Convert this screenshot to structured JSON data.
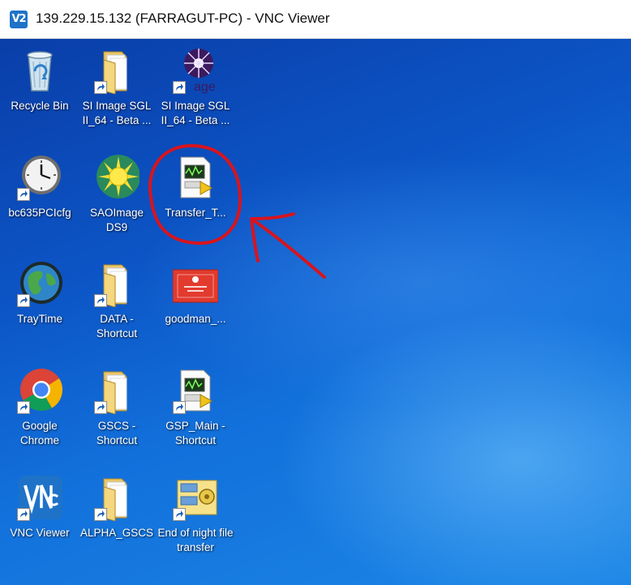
{
  "window": {
    "badge": "V2",
    "title": "139.229.15.132 (FARRAGUT-PC) - VNC Viewer"
  },
  "desktop": {
    "icons": [
      {
        "label": "Recycle Bin",
        "icon": "recycle-bin-icon"
      },
      {
        "label": "SI Image SGL II_64 - Beta ...",
        "icon": "folder-icon"
      },
      {
        "label": "SI Image SGL II_64 - Beta ...",
        "icon": "si-image-app-icon",
        "overlay": "age"
      },
      {
        "label": "bc635PCIcfg",
        "icon": "clock-icon"
      },
      {
        "label": "SAOImage DS9",
        "icon": "sun-icon"
      },
      {
        "label": "Transfer_T...",
        "icon": "labview-vi-icon"
      },
      {
        "label": "TrayTime",
        "icon": "globe-icon"
      },
      {
        "label": "DATA - Shortcut",
        "icon": "folder-icon"
      },
      {
        "label": "goodman_...",
        "icon": "red-document-icon"
      },
      {
        "label": "Google Chrome",
        "icon": "chrome-icon"
      },
      {
        "label": "GSCS - Shortcut",
        "icon": "folder-icon"
      },
      {
        "label": "GSP_Main - Shortcut",
        "icon": "labview-vi-icon"
      },
      {
        "label": "VNC Viewer",
        "icon": "vnc-icon"
      },
      {
        "label": "ALPHA_GSCS",
        "icon": "folder-icon"
      },
      {
        "label": "End of night file transfer",
        "icon": "batch-file-icon"
      }
    ]
  },
  "colors": {
    "desktop_top": "#0a3ea8",
    "desktop_bottom": "#1c86e6",
    "annotation_red": "#d8141e"
  }
}
